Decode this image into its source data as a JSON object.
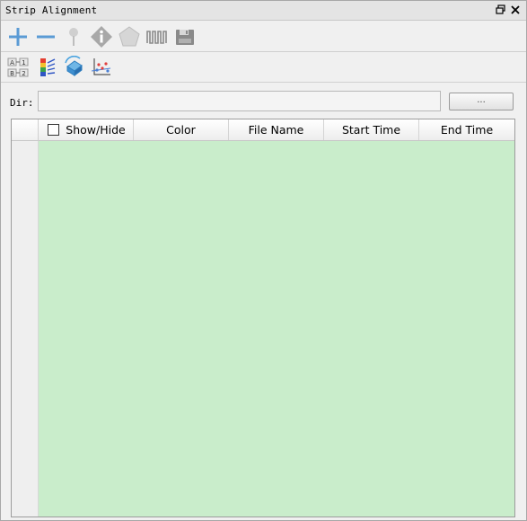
{
  "window": {
    "title": "Strip Alignment",
    "float_icon": "float-restore-icon",
    "close_icon": "close-icon"
  },
  "toolbar1": [
    {
      "name": "add-icon",
      "color": "#5b9bd5"
    },
    {
      "name": "remove-icon",
      "color": "#5b9bd5"
    },
    {
      "name": "pin-icon",
      "color": "#bdbdbd"
    },
    {
      "name": "info-icon",
      "color": "#9a9a9a"
    },
    {
      "name": "pentagon-icon",
      "color": "#bdbdbd"
    },
    {
      "name": "waveform-icon",
      "color": "#8a8a8a"
    },
    {
      "name": "save-icon",
      "color": "#8a8a8a"
    }
  ],
  "toolbar2": [
    {
      "name": "ab-compare-icon"
    },
    {
      "name": "color-bars-icon"
    },
    {
      "name": "rotate-cube-icon"
    },
    {
      "name": "scatter-axis-icon"
    }
  ],
  "dir": {
    "label": "Dir:",
    "value": "",
    "browse_label": "..."
  },
  "table": {
    "columns": [
      "Show/Hide",
      "Color",
      "File Name",
      "Start Time",
      "End Time"
    ],
    "rows": [],
    "header_checked": false,
    "body_color": "#c9edcb"
  }
}
